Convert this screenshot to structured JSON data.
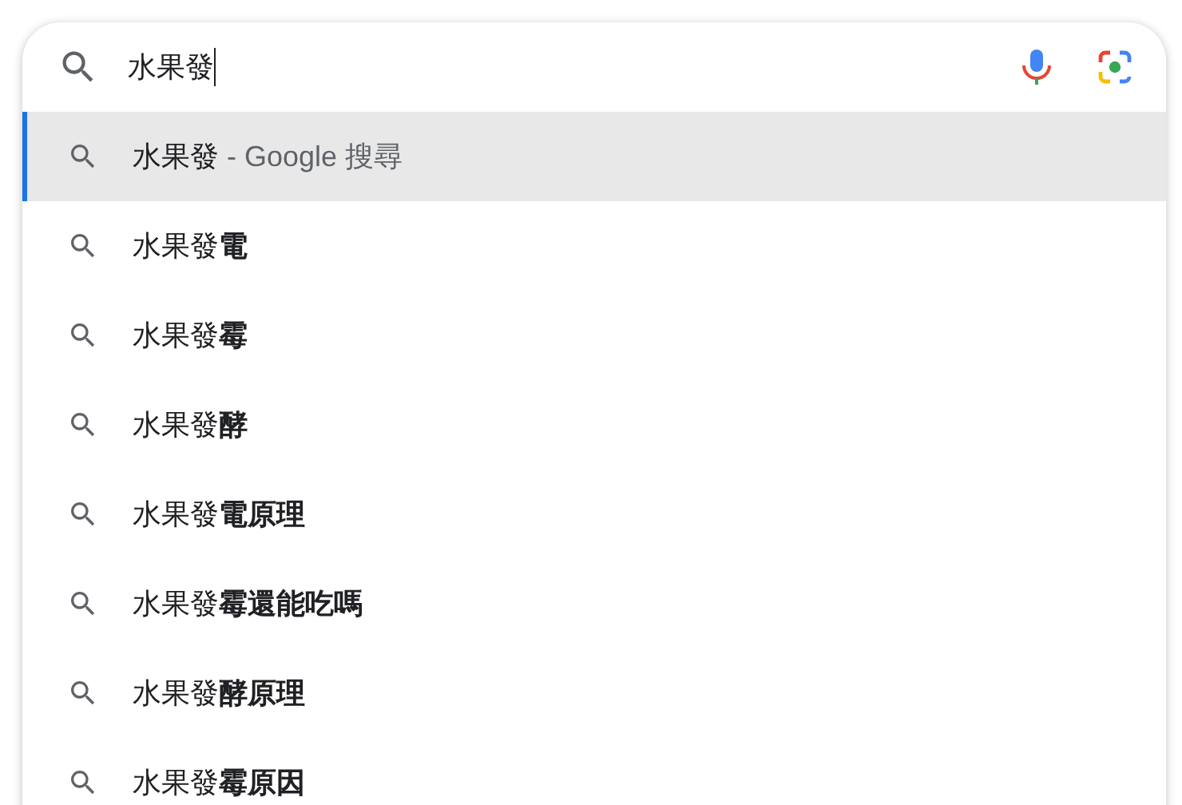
{
  "search": {
    "value": "水果發"
  },
  "suggestions": [
    {
      "kind": "search",
      "text": "水果發",
      "suffix": " - Google 搜尋",
      "selected": true
    },
    {
      "kind": "query",
      "text": "水果發**電**",
      "selected": false
    },
    {
      "kind": "query",
      "text": "水果發**霉**",
      "selected": false
    },
    {
      "kind": "query",
      "text": "水果發**酵**",
      "selected": false
    },
    {
      "kind": "query",
      "text": "水果發**電原理**",
      "selected": false
    },
    {
      "kind": "query",
      "text": "水果發**霉還能吃嗎**",
      "selected": false
    },
    {
      "kind": "query",
      "text": "水果發**酵原理**",
      "selected": false
    },
    {
      "kind": "query",
      "text": "水果發**霉原因**",
      "selected": false
    }
  ]
}
